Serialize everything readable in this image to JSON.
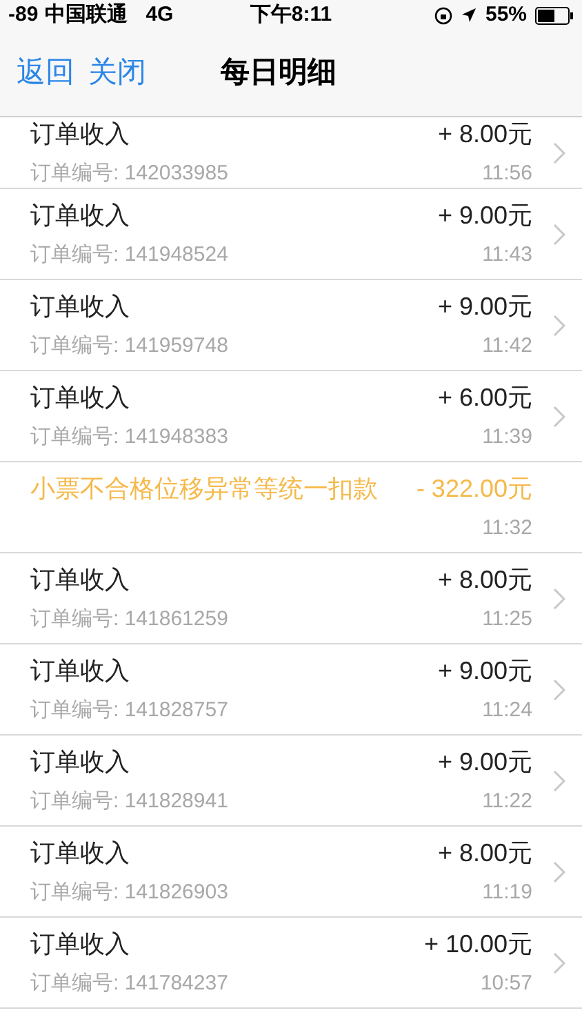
{
  "status_bar": {
    "signal": "-89",
    "carrier": "中国联通",
    "network": "4G",
    "time": "下午8:11",
    "battery": "55%"
  },
  "nav": {
    "back": "返回",
    "close": "关闭",
    "title": "每日明细"
  },
  "rows": [
    {
      "kind": "income",
      "title": "订单收入",
      "amount": "+ 8.00元",
      "order": "订单编号: 142033985",
      "time": "11:56"
    },
    {
      "kind": "income",
      "title": "订单收入",
      "amount": "+ 9.00元",
      "order": "订单编号: 141948524",
      "time": "11:43"
    },
    {
      "kind": "income",
      "title": "订单收入",
      "amount": "+ 9.00元",
      "order": "订单编号: 141959748",
      "time": "11:42"
    },
    {
      "kind": "income",
      "title": "订单收入",
      "amount": "+ 6.00元",
      "order": "订单编号: 141948383",
      "time": "11:39"
    },
    {
      "kind": "deduction",
      "title": "小票不合格位移异常等统一扣款",
      "amount": "- 322.00元",
      "time": "11:32"
    },
    {
      "kind": "income",
      "title": "订单收入",
      "amount": "+ 8.00元",
      "order": "订单编号: 141861259",
      "time": "11:25"
    },
    {
      "kind": "income",
      "title": "订单收入",
      "amount": "+ 9.00元",
      "order": "订单编号: 141828757",
      "time": "11:24"
    },
    {
      "kind": "income",
      "title": "订单收入",
      "amount": "+ 9.00元",
      "order": "订单编号: 141828941",
      "time": "11:22"
    },
    {
      "kind": "income",
      "title": "订单收入",
      "amount": "+ 8.00元",
      "order": "订单编号: 141826903",
      "time": "11:19"
    },
    {
      "kind": "income",
      "title": "订单收入",
      "amount": "+ 10.00元",
      "order": "订单编号: 141784237",
      "time": "10:57"
    }
  ]
}
